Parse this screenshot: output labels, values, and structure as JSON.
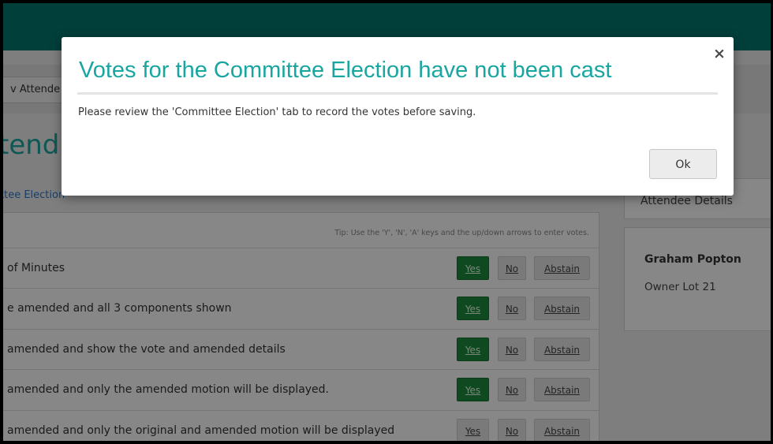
{
  "toolbar": {
    "attendee_button_label": "v Attende"
  },
  "page": {
    "title": "tend",
    "active_tab": "ttee Election"
  },
  "votes": {
    "tip": "Tip: Use the 'Y', 'N', 'A' keys and the up/down arrows to enter votes.",
    "yes_label": "Yes",
    "no_label": "No",
    "abstain_label": "Abstain",
    "rows": [
      {
        "text": "of Minutes",
        "vote": "Yes"
      },
      {
        "text": "e amended and all 3 components shown",
        "vote": "Yes"
      },
      {
        "text": "amended and show the vote and amended details",
        "vote": "Yes"
      },
      {
        "text": "amended and only the amended motion will be displayed.",
        "vote": "Yes"
      },
      {
        "text": "amended and only the original and amended motion will be displayed",
        "vote": ""
      }
    ]
  },
  "sidebar": {
    "tab": "Attendee Details",
    "attendee_name": "Graham Popton",
    "attendee_role": "Owner  Lot 21"
  },
  "modal": {
    "title": "Votes for the Committee Election have not been cast",
    "message": "Please review the 'Committee Election' tab to record the votes before saving.",
    "ok_label": "Ok",
    "close_glyph": "×"
  },
  "colors": {
    "accent": "#1aa6a0",
    "header": "#00786f",
    "yes_selected": "#1e8a3c"
  }
}
